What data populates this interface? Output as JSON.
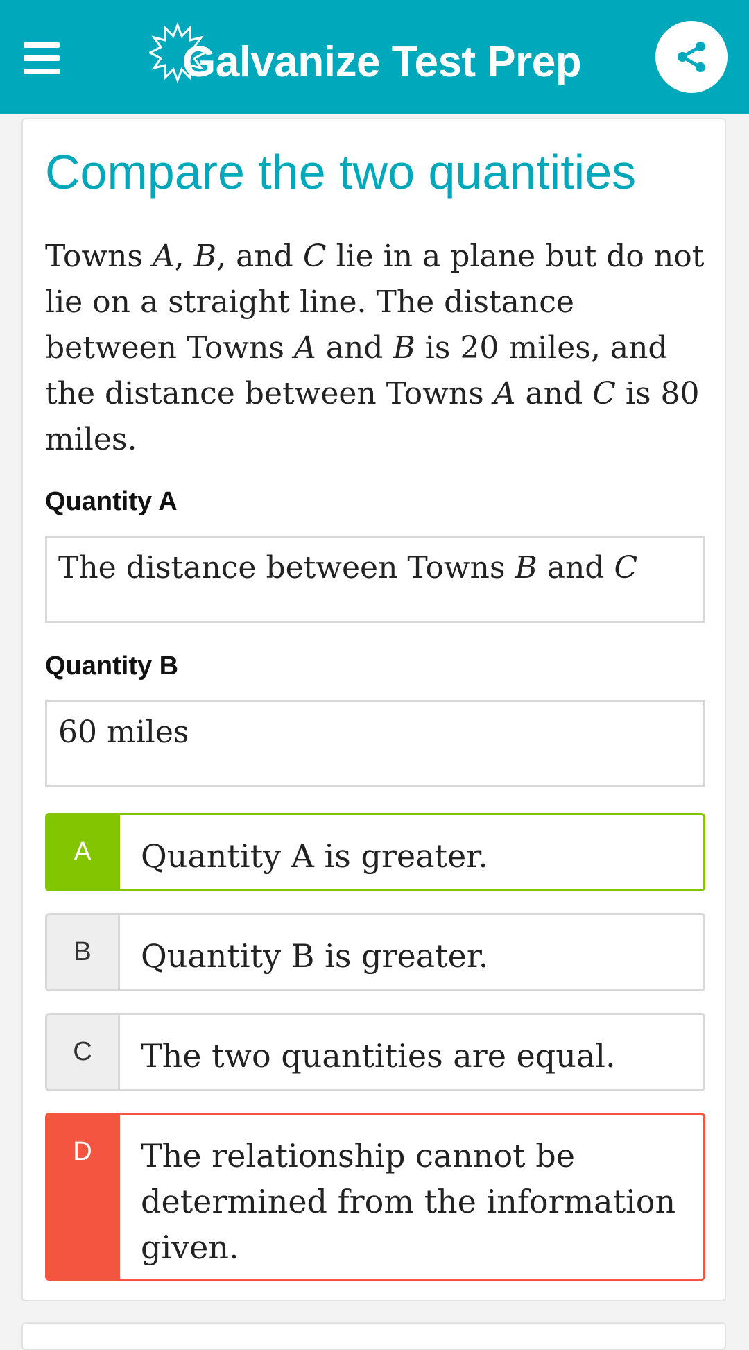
{
  "header": {
    "title": "Galvanize Test Prep",
    "brand_color": "#00a8bb",
    "icons": [
      "menu-icon",
      "galvanize-logo",
      "share-icon"
    ]
  },
  "card": {
    "title": "Compare the two quantities",
    "question": [
      "Towns ",
      {
        "var": "A"
      },
      ", ",
      {
        "var": "B"
      },
      ", and ",
      {
        "var": "C"
      },
      " lie in a plane but do not lie on a straight line. The distance between Towns ",
      {
        "var": "A"
      },
      " and ",
      {
        "var": "B"
      },
      " is 20 miles, and the distance between Towns ",
      {
        "var": "A"
      },
      " and ",
      {
        "var": "C"
      },
      " is 80 miles."
    ],
    "quantity_a": {
      "label": "Quantity A",
      "value": [
        "The distance between Towns ",
        {
          "var": "B"
        },
        " and ",
        {
          "var": "C"
        }
      ]
    },
    "quantity_b": {
      "label": "Quantity B",
      "value": "60 miles"
    },
    "choices": [
      {
        "letter": "A",
        "text": "Quantity A is greater.",
        "status": "correct"
      },
      {
        "letter": "B",
        "text": "Quantity B is greater.",
        "status": "neutral"
      },
      {
        "letter": "C",
        "text": "The two quantities are equal.",
        "status": "neutral"
      },
      {
        "letter": "D",
        "text": "The relationship cannot be determined from the information given.",
        "status": "wrong"
      }
    ],
    "colors": {
      "correct": "#82c500",
      "wrong": "#f35541"
    }
  }
}
